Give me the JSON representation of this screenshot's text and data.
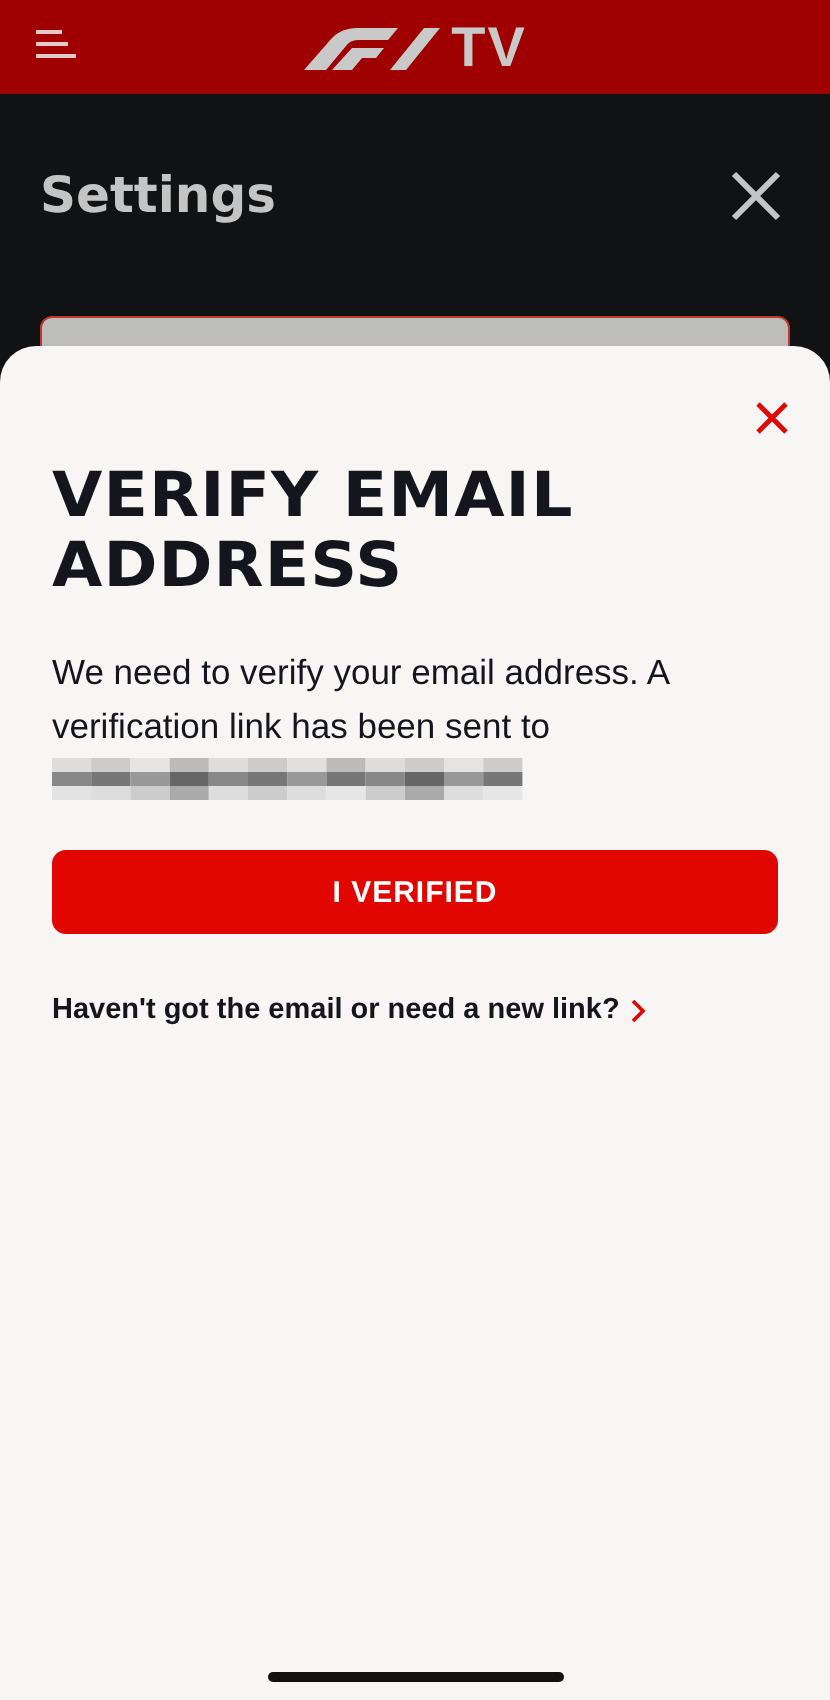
{
  "app_bar": {
    "brand": "TV"
  },
  "page": {
    "title": "Settings"
  },
  "sheet": {
    "title": "VERIFY EMAIL ADDRESS",
    "message": "We need to verify your email address. A verification link has been sent to",
    "primary_button": "I VERIFIED",
    "resend_link": "Haven't got the email or need a new link?"
  }
}
